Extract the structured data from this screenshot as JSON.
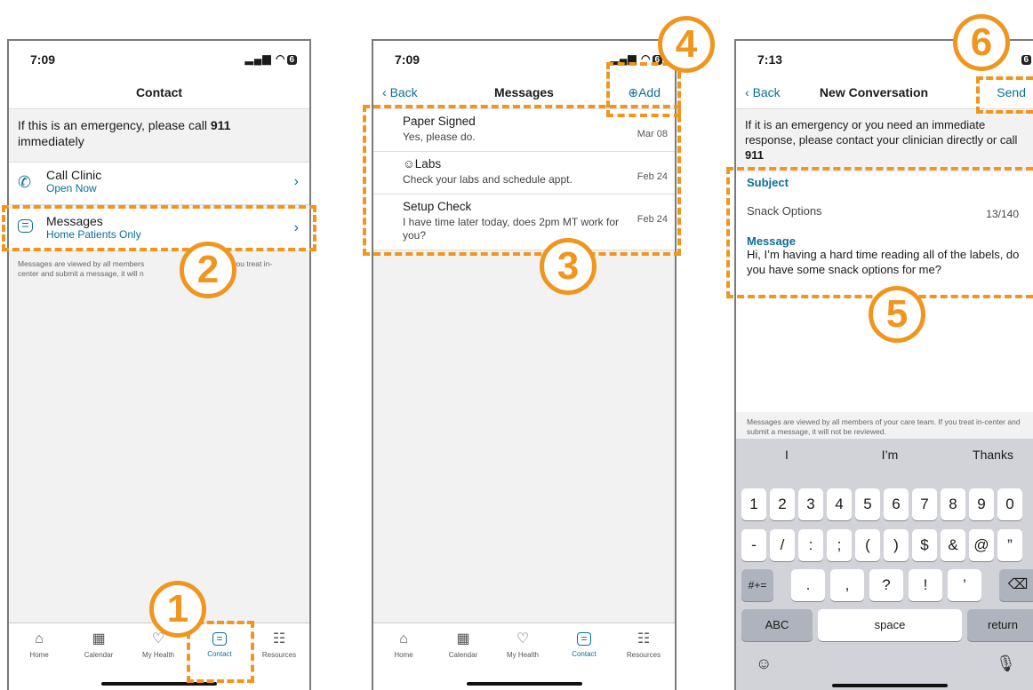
{
  "screen1": {
    "time": "7:09",
    "signal": "▂▄▆ ◠",
    "battery": "6",
    "title": "Contact",
    "emergency_prefix": "If this is an emergency, please call ",
    "emergency_number": "911",
    "emergency_suffix": "immediately",
    "call_clinic": {
      "title": "Call Clinic",
      "sub": "Open Now"
    },
    "messages": {
      "title": "Messages",
      "sub": "Home Patients Only"
    },
    "disclaimer_line1": "Messages are viewed by all members",
    "disclaimer_line1b": "If you treat in-",
    "disclaimer_line2": "center and submit a message, it will n",
    "tabs": [
      {
        "label": "Home",
        "icon": "home-icon"
      },
      {
        "label": "Calendar",
        "icon": "calendar-icon"
      },
      {
        "label": "My Health",
        "icon": "heart-icon"
      },
      {
        "label": "Contact",
        "icon": "chat-icon"
      },
      {
        "label": "Resources",
        "icon": "book-icon"
      }
    ]
  },
  "screen2": {
    "time": "7:09",
    "battery": "6",
    "back": "Back",
    "title": "Messages",
    "add": "Add",
    "messages": [
      {
        "title": "Paper Signed",
        "preview": "Yes, please do.",
        "date": "Mar 08"
      },
      {
        "title": "Labs",
        "preview": "Check your labs and schedule appt.",
        "date": "Feb 24"
      },
      {
        "title": "Setup Check",
        "preview": "I have time later today, does 2pm MT work for you?",
        "date": "Feb 24"
      }
    ],
    "tabs": [
      {
        "label": "Home"
      },
      {
        "label": "Calendar"
      },
      {
        "label": "My Health"
      },
      {
        "label": "Contact"
      },
      {
        "label": "Resources"
      }
    ]
  },
  "screen3": {
    "time": "7:13",
    "battery": "6",
    "back": "Back",
    "title": "New Conversation",
    "send": "Send",
    "emergency_text": "If it is an emergency or you need an immediate response, please contact your clinician directly or call ",
    "emergency_number": "911",
    "subject_label": "Subject",
    "subject_value": "Snack Options",
    "subject_counter": "13/140",
    "message_label": "Message",
    "message_value": "Hi, I’m having a hard time reading all of the labels, do you have some snack options for me?",
    "disclaimer": "Messages are viewed by all members of your care team. If you treat in-center and submit a message, it will not be reviewed.",
    "keyboard": {
      "suggestions": [
        "I",
        "I’m",
        "Thanks"
      ],
      "row1": [
        "1",
        "2",
        "3",
        "4",
        "5",
        "6",
        "7",
        "8",
        "9",
        "0"
      ],
      "row2": [
        "-",
        "/",
        ":",
        ";",
        "(",
        ")",
        "$",
        "&",
        "@",
        "”"
      ],
      "symbols_key": "#+=",
      "row3": [
        ".",
        ",",
        "?",
        "!",
        "’"
      ],
      "abc": "ABC",
      "space": "space",
      "return": "return"
    }
  },
  "callouts": [
    "1",
    "2",
    "3",
    "4",
    "5",
    "6"
  ],
  "colors": {
    "accent": "#0a6f95",
    "callout": "#f0961f"
  }
}
